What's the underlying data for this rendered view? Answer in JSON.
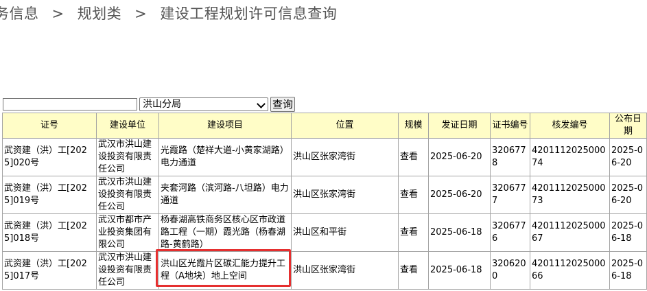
{
  "breadcrumb": {
    "items": [
      "务信息",
      "规划类",
      "建设工程规划许可信息查询"
    ],
    "separator": ">"
  },
  "search": {
    "keyword_value": "",
    "branch_selected": "洪山分局",
    "query_label": "查询"
  },
  "table": {
    "headers": [
      "证号",
      "建设单位",
      "建设项目",
      "位置",
      "规模",
      "发证日期",
      "证书编号",
      "核发编号",
      "公布日期"
    ],
    "rows": [
      {
        "permit_no": "武资建（洪）工[2025]020号",
        "unit": "武汉市洪山建设投资有限责任公司",
        "project": "光霞路（楚祥大道-小黄家湖路）电力通道",
        "location": "洪山区张家湾街",
        "scale": "查看",
        "issue_date": "2025-06-20",
        "cert_no": "3206778",
        "approval_no": "420111202500074",
        "publish_date": "2025-06-20"
      },
      {
        "permit_no": "武资建（洪）工[2025]019号",
        "unit": "武汉市洪山建设投资有限责任公司",
        "project": "夹套河路（滨河路-八坦路）电力通道",
        "location": "洪山区张家湾街",
        "scale": "查看",
        "issue_date": "2025-06-20",
        "cert_no": "3206777",
        "approval_no": "420111202500073",
        "publish_date": "2025-06-20"
      },
      {
        "permit_no": "武资建（洪）工[2025]018号",
        "unit": "武汉市都市产业投资集团有限公司",
        "project": "杨春湖高铁商务区核心区市政道路工程（一期）霞光路（杨春湖路-黄鹤路）",
        "location": "洪山区和平街",
        "scale": "查看",
        "issue_date": "2025-06-18",
        "cert_no": "3206776",
        "approval_no": "420111202500067",
        "publish_date": "2025-06-18"
      },
      {
        "permit_no": "武资建（洪）工[2025]017号",
        "unit": "武汉市洪山建设投资有限责任公司",
        "project": "洪山区光霞片区碳汇能力提升工程（A地块）地上空间",
        "location": "洪山区张家湾街",
        "scale": "查看",
        "issue_date": "2025-06-18",
        "cert_no": "3206200",
        "approval_no": "420111202500066",
        "publish_date": "2025-06-18"
      }
    ]
  },
  "highlight_color": "#e52f2f"
}
